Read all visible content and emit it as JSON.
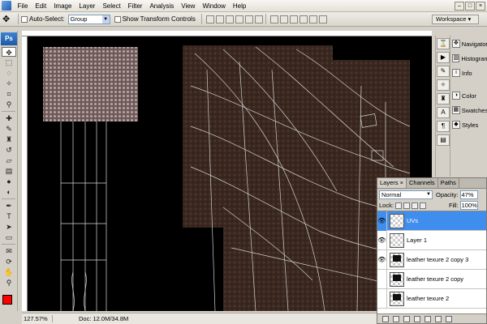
{
  "menubar": {
    "items": [
      "File",
      "Edit",
      "Image",
      "Layer",
      "Select",
      "Filter",
      "Analysis",
      "View",
      "Window",
      "Help"
    ]
  },
  "options": {
    "auto_select_label": "Auto-Select:",
    "auto_select_value": "Group",
    "show_transform_label": "Show Transform Controls",
    "workspace_label": "Workspace"
  },
  "toolbox": {
    "logo": "Ps",
    "foreground_color": "#ff0000",
    "background_color": "#ffffff"
  },
  "panels": {
    "navigator": "Navigator",
    "histogram": "Histogram",
    "info": "Info",
    "color": "Color",
    "swatches": "Swatches",
    "styles": "Styles"
  },
  "layers_panel": {
    "tabs": [
      "Layers",
      "Channels",
      "Paths"
    ],
    "blend_mode": "Normal",
    "opacity_label": "Opacity:",
    "opacity_value": "47%",
    "lock_label": "Lock:",
    "fill_label": "Fill:",
    "fill_value": "100%",
    "layers": [
      {
        "name": "UVs",
        "visible": true,
        "selected": true
      },
      {
        "name": "Layer 1",
        "visible": true,
        "selected": false
      },
      {
        "name": "leather texure 2 copy 3",
        "visible": true,
        "selected": false
      },
      {
        "name": "leather texure 2 copy",
        "visible": false,
        "selected": false
      },
      {
        "name": "leather texure 2",
        "visible": false,
        "selected": false
      }
    ]
  },
  "status": {
    "zoom": "127.57%",
    "doc": "Doc: 12.0M/34.8M"
  }
}
